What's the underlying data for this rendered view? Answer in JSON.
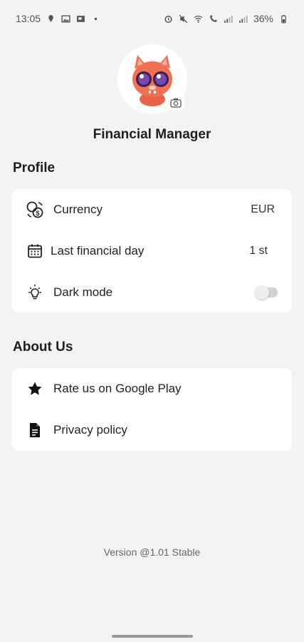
{
  "status_bar": {
    "time": "13:05",
    "battery": "36%"
  },
  "header": {
    "app_title": "Financial Manager"
  },
  "profile": {
    "section_title": "Profile",
    "items": [
      {
        "label": "Currency",
        "value": "EUR",
        "icon": "currency-exchange-icon"
      },
      {
        "label": "Last financial day",
        "value": "1 st",
        "icon": "calendar-icon"
      },
      {
        "label": "Dark mode",
        "toggle_on": false,
        "icon": "lightbulb-icon"
      }
    ]
  },
  "about": {
    "section_title": "About Us",
    "items": [
      {
        "label": "Rate us on Google Play",
        "icon": "star-icon"
      },
      {
        "label": "Privacy policy",
        "icon": "document-icon"
      }
    ]
  },
  "footer": {
    "version": "Version @1.01 Stable"
  }
}
